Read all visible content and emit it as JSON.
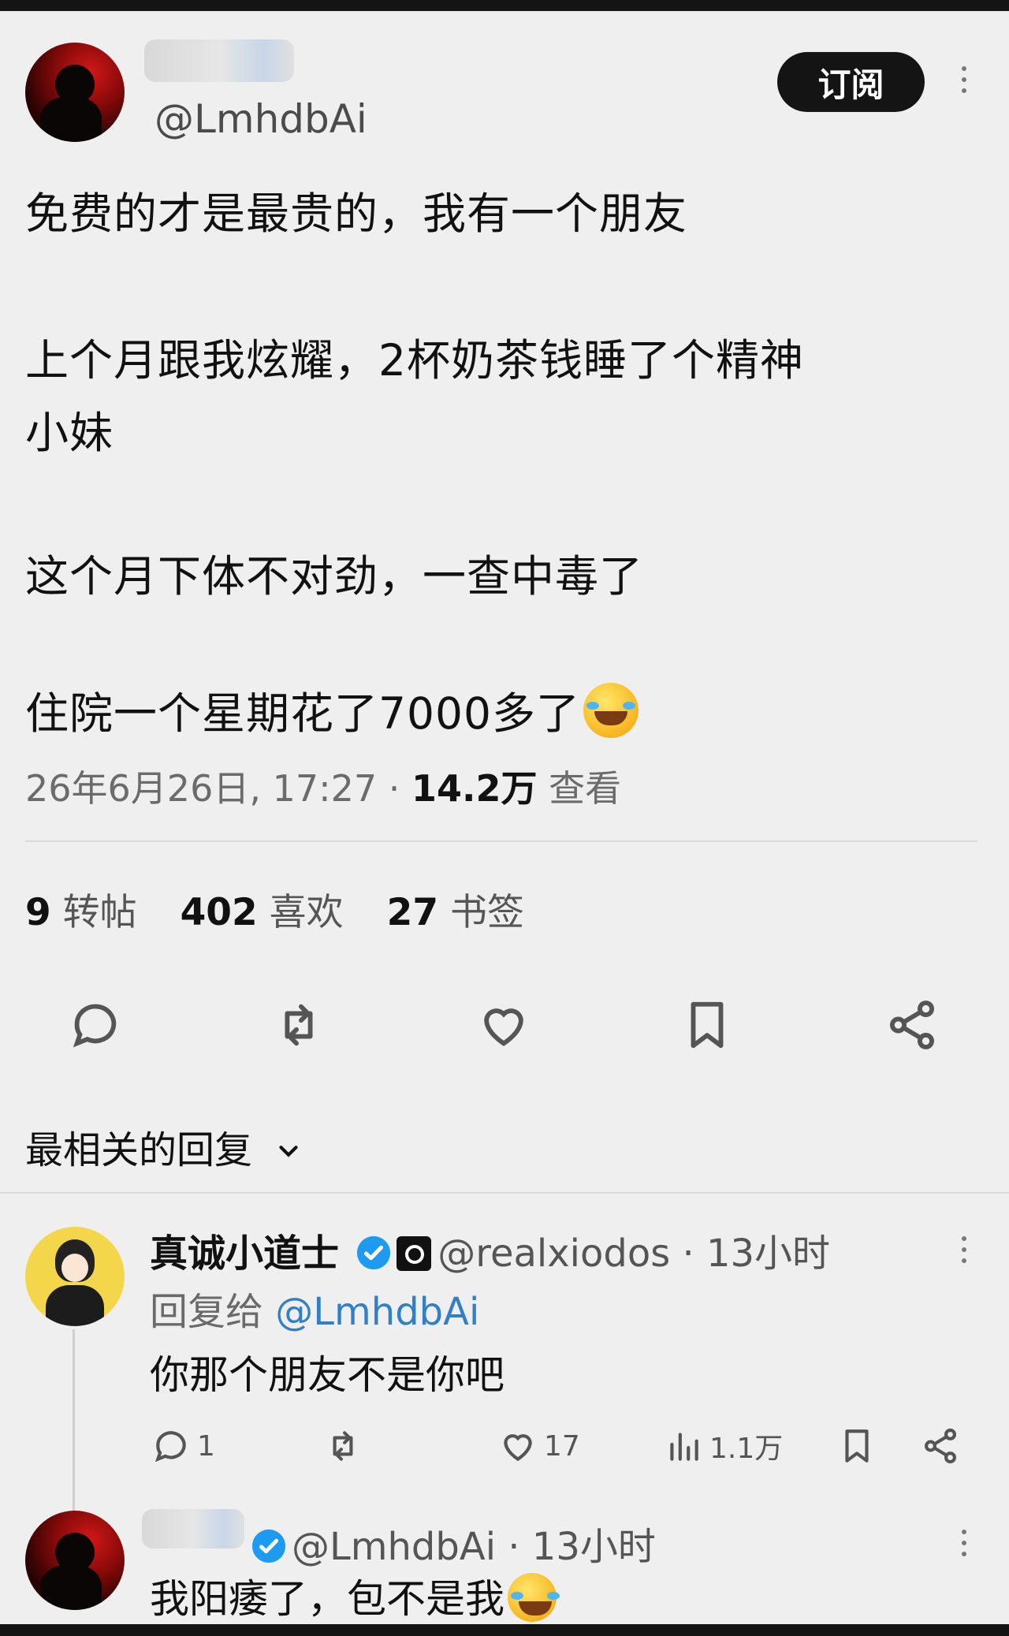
{
  "post": {
    "handle": "@LmhdbAi",
    "subscribe_label": "订阅",
    "lines": [
      "免费的才是最贵的，我有一个朋友",
      "上个月跟我炫耀，2杯奶茶钱睡了个精神",
      "小妹",
      "这个月下体不对劲，一查中毒了",
      "住院一个星期花了7000多了"
    ],
    "end_emoji": "face-with-tears-of-joy-emoji",
    "meta": {
      "date": "26年6月26日, 17:27 · ",
      "views_value": "14.2万",
      "views_label": " 查看"
    },
    "stats": {
      "reposts_count": "9",
      "reposts_label": " 转帖",
      "likes_count": "402",
      "likes_label": " 喜欢",
      "bookmarks_count": "27",
      "bookmarks_label": " 书签"
    },
    "actions": [
      "reply-icon",
      "repost-icon",
      "like-icon",
      "bookmark-icon",
      "share-icon"
    ]
  },
  "replies_sort_label": "最相关的回复",
  "replies": [
    {
      "name": "真诚小道士",
      "handle": "@realxiodos",
      "time": " · 13小时",
      "reply_to_prefix": "回复给 ",
      "reply_to_handle": "@LmhdbAi",
      "text": "你那个朋友不是你吧",
      "reply_count": "1",
      "like_count": "17",
      "view_count": "1.1万"
    },
    {
      "handle": "@LmhdbAi",
      "time": " · 13小时",
      "text": "我阳痿了，包不是我"
    }
  ],
  "colors": {
    "accent": "#2f80c8",
    "verified": "#1d9bf0",
    "background": "#efefef"
  }
}
